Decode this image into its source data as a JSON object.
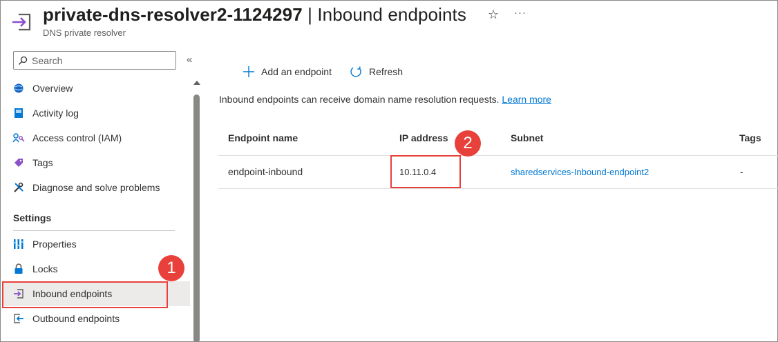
{
  "header": {
    "resource_name": "private-dns-resolver2-1124297",
    "separator": "|",
    "page_name": "Inbound endpoints",
    "subtitle": "DNS private resolver",
    "favorite_icon": "☆",
    "more_icon": "···"
  },
  "sidebar": {
    "search_placeholder": "Search",
    "collapse_icon": "«",
    "items": [
      {
        "label": "Overview",
        "icon": "overview-icon"
      },
      {
        "label": "Activity log",
        "icon": "activity-log-icon"
      },
      {
        "label": "Access control (IAM)",
        "icon": "iam-icon"
      },
      {
        "label": "Tags",
        "icon": "tag-icon"
      },
      {
        "label": "Diagnose and solve problems",
        "icon": "wrench-icon"
      }
    ],
    "settings_heading": "Settings",
    "settings_items": [
      {
        "label": "Properties",
        "icon": "properties-icon"
      },
      {
        "label": "Locks",
        "icon": "lock-icon"
      },
      {
        "label": "Inbound endpoints",
        "icon": "inbound-icon",
        "active": true
      },
      {
        "label": "Outbound endpoints",
        "icon": "outbound-icon"
      }
    ]
  },
  "toolbar": {
    "add_label": "Add an endpoint",
    "refresh_label": "Refresh"
  },
  "info": {
    "text": "Inbound endpoints can receive domain name resolution requests.",
    "link": "Learn more"
  },
  "table": {
    "columns": [
      "Endpoint name",
      "IP address",
      "Subnet",
      "Tags"
    ],
    "rows": [
      {
        "endpoint_name": "endpoint-inbound",
        "ip_address": "10.11.0.4",
        "subnet": "sharedservices-Inbound-endpoint2",
        "tags": "-"
      }
    ]
  },
  "annotations": {
    "badge_1": "1",
    "badge_2": "2",
    "color": "#e8413b"
  },
  "colors": {
    "accent": "#0078d4",
    "resource_icon": "#8a4fc9"
  }
}
